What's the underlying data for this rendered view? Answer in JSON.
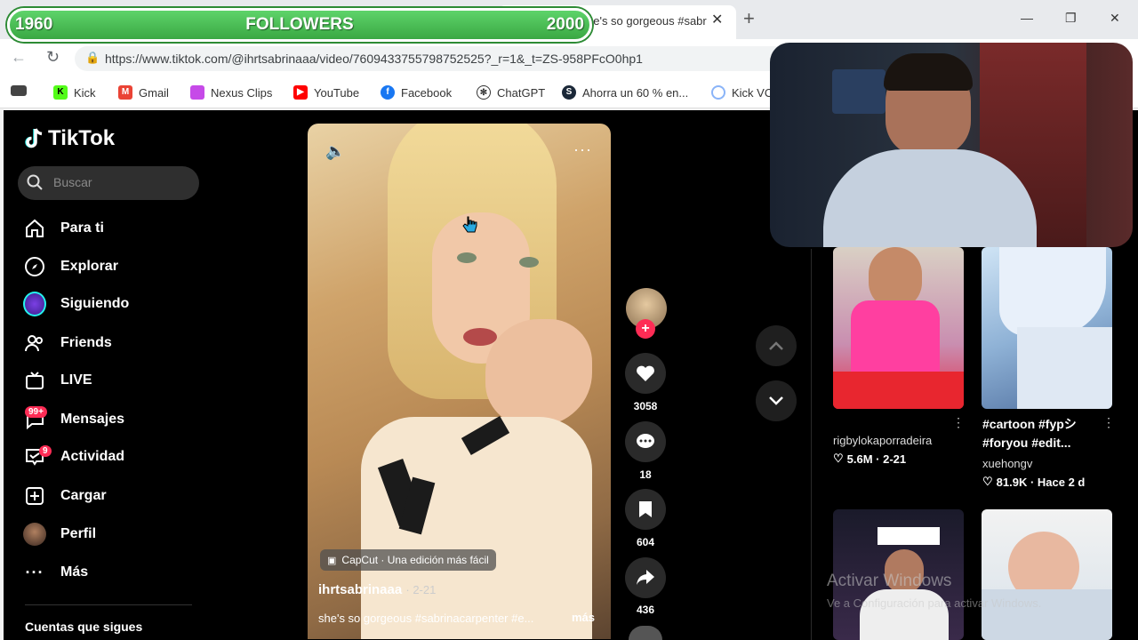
{
  "overlay": {
    "left_value": "1960",
    "label": "FOLLOWERS",
    "right_value": "2000"
  },
  "browser": {
    "tab_title": "he's so gorgeous #sabr",
    "url": "https://www.tiktok.com/@ihrtsabrinaaa/video/7609433755798752525?_r=1&_t=ZS-958PFcO0hp1",
    "bookmarks": [
      "Kick",
      "Gmail",
      "Nexus Clips",
      "YouTube",
      "Facebook",
      "ChatGPT",
      "Ahorra un 60 % en...",
      "Kick VO"
    ]
  },
  "sidebar": {
    "logo": "TikTok",
    "search_placeholder": "Buscar",
    "items": [
      {
        "label": "Para ti",
        "icon": "home-icon"
      },
      {
        "label": "Explorar",
        "icon": "compass-icon"
      },
      {
        "label": "Siguiendo",
        "icon": "following-icon"
      },
      {
        "label": "Friends",
        "icon": "friends-icon"
      },
      {
        "label": "LIVE",
        "icon": "live-icon"
      },
      {
        "label": "Mensajes",
        "icon": "messages-icon",
        "badge": "99+"
      },
      {
        "label": "Actividad",
        "icon": "activity-icon",
        "badge": "9"
      },
      {
        "label": "Cargar",
        "icon": "upload-icon"
      },
      {
        "label": "Perfil",
        "icon": "profile-avatar"
      },
      {
        "label": "Más",
        "icon": "more-icon"
      }
    ],
    "following_title": "Cuentas que sigues"
  },
  "video": {
    "capcut": "CapCut · Una edición más fácil",
    "author": "ihrtsabrinaaa",
    "date": "· 2-21",
    "description": "she's so gorgeous #sabrinacarpenter #e...",
    "more": "más",
    "likes": "3058",
    "comments": "18",
    "saves": "604",
    "shares": "436"
  },
  "related": [
    {
      "caption": "",
      "user": "rigbylokaporradeira",
      "stats": "5.6M · 2-21"
    },
    {
      "caption": "#cartoon #fypシ #foryou #edit...",
      "user": "xuehongv",
      "stats": "81.9K · Hace 2 d"
    }
  ],
  "watermark": {
    "title": "Activar Windows",
    "sub": "Ve a Configuración para activar Windows."
  },
  "colors": {
    "accent": "#fe2c55",
    "overlay_green": "#3aa843"
  }
}
